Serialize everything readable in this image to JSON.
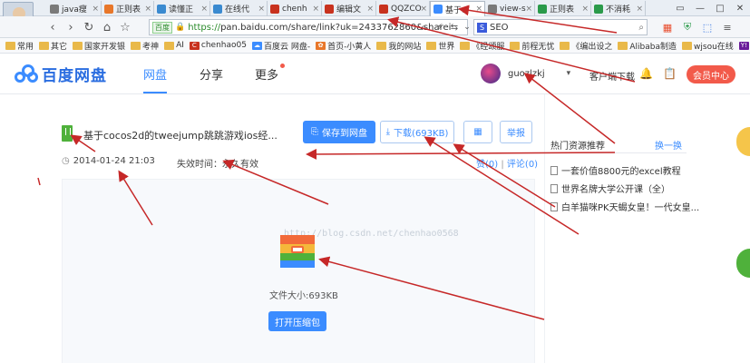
{
  "browser": {
    "tabs": [
      {
        "label": "java瘦",
        "icon_color": "#7a7a7a",
        "active": false
      },
      {
        "label": "正则表",
        "icon_color": "#e8772a",
        "active": false
      },
      {
        "label": "读懂正",
        "icon_color": "#3a8ad0",
        "active": false
      },
      {
        "label": "在线代",
        "icon_color": "#3a8ad0",
        "active": false
      },
      {
        "label": "chenh",
        "icon_color": "#c8321e",
        "active": false
      },
      {
        "label": "编辑文",
        "icon_color": "#c8321e",
        "active": false
      },
      {
        "label": "QQZCO",
        "icon_color": "#c8321e",
        "active": false
      },
      {
        "label": "基于c",
        "icon_color": "#3b8cff",
        "active": true
      },
      {
        "label": "view-s",
        "icon_color": "#7a7a7a",
        "active": false
      },
      {
        "label": "正则表",
        "icon_color": "#2a9a4a",
        "active": false
      },
      {
        "label": "不消耗",
        "icon_color": "#2a9a4a",
        "active": false
      }
    ],
    "tab_close_glyph": "×",
    "window_controls": [
      "▭",
      "—",
      "□",
      "✕"
    ],
    "address": {
      "badge": "百度",
      "scheme": "https://",
      "rest": "pan.baidu.com/share/link?uk=2433762860&sharei"
    },
    "search_value": "SEO",
    "search_badge": "S",
    "bookmarks": [
      {
        "label": "常用",
        "kind": "folder"
      },
      {
        "label": "其它",
        "kind": "folder"
      },
      {
        "label": "国家开发银",
        "kind": "folder"
      },
      {
        "label": "考神",
        "kind": "folder"
      },
      {
        "label": "AI",
        "kind": "folder"
      },
      {
        "label": "chenhao05",
        "kind": "site",
        "icon": "C",
        "color": "#c8321e"
      },
      {
        "label": "百度云 网盘-",
        "kind": "site",
        "icon": "☁",
        "color": "#3b8cff"
      },
      {
        "label": "首页-小黄人",
        "kind": "site",
        "icon": "✿",
        "color": "#e8772a"
      },
      {
        "label": "我的网站",
        "kind": "folder"
      },
      {
        "label": "世界",
        "kind": "folder"
      },
      {
        "label": "《经颂服",
        "kind": "folder"
      },
      {
        "label": "前程无忧",
        "kind": "folder"
      },
      {
        "label": "《编出设之",
        "kind": "folder"
      },
      {
        "label": "Alibaba制造",
        "kind": "folder"
      },
      {
        "label": "wjsou在线",
        "kind": "folder"
      },
      {
        "label": "Yahoo!",
        "kind": "site",
        "icon": "Y!",
        "color": "#6a1b9a"
      }
    ]
  },
  "header": {
    "logo_text": "百度网盘",
    "nav": [
      {
        "label": "网盘",
        "active": true
      },
      {
        "label": "分享",
        "active": false
      },
      {
        "label": "更多",
        "active": false,
        "dot": true
      }
    ],
    "username": "guozlzkj",
    "client_download": "客户端下载",
    "vip_button": "会员中心",
    "colors": {
      "accent": "#3b8cff",
      "vip": "#f25a4a"
    }
  },
  "file": {
    "title": "基于cocos2d的tweejump跳跳游戏ios经...",
    "save_button": "保存到网盘",
    "download_button": "下载(693KB)",
    "report_button": "举报",
    "share_time": "2014-01-24 21:03",
    "expiry": "失效时间：永久有效",
    "likes": "赞(0)",
    "comments": "评论(0)",
    "watermark": "http://blog.csdn.net/chenhao0568",
    "size_text": "文件大小:693KB",
    "open_button": "打开压缩包"
  },
  "sidebar": {
    "title": "热门资源推荐",
    "refresh": "换一换",
    "items": [
      "一套价值8800元的excel教程",
      "世界名牌大学公开课（全）",
      "白羊猫咪PK天蝎女皇！一代女皇..."
    ]
  }
}
